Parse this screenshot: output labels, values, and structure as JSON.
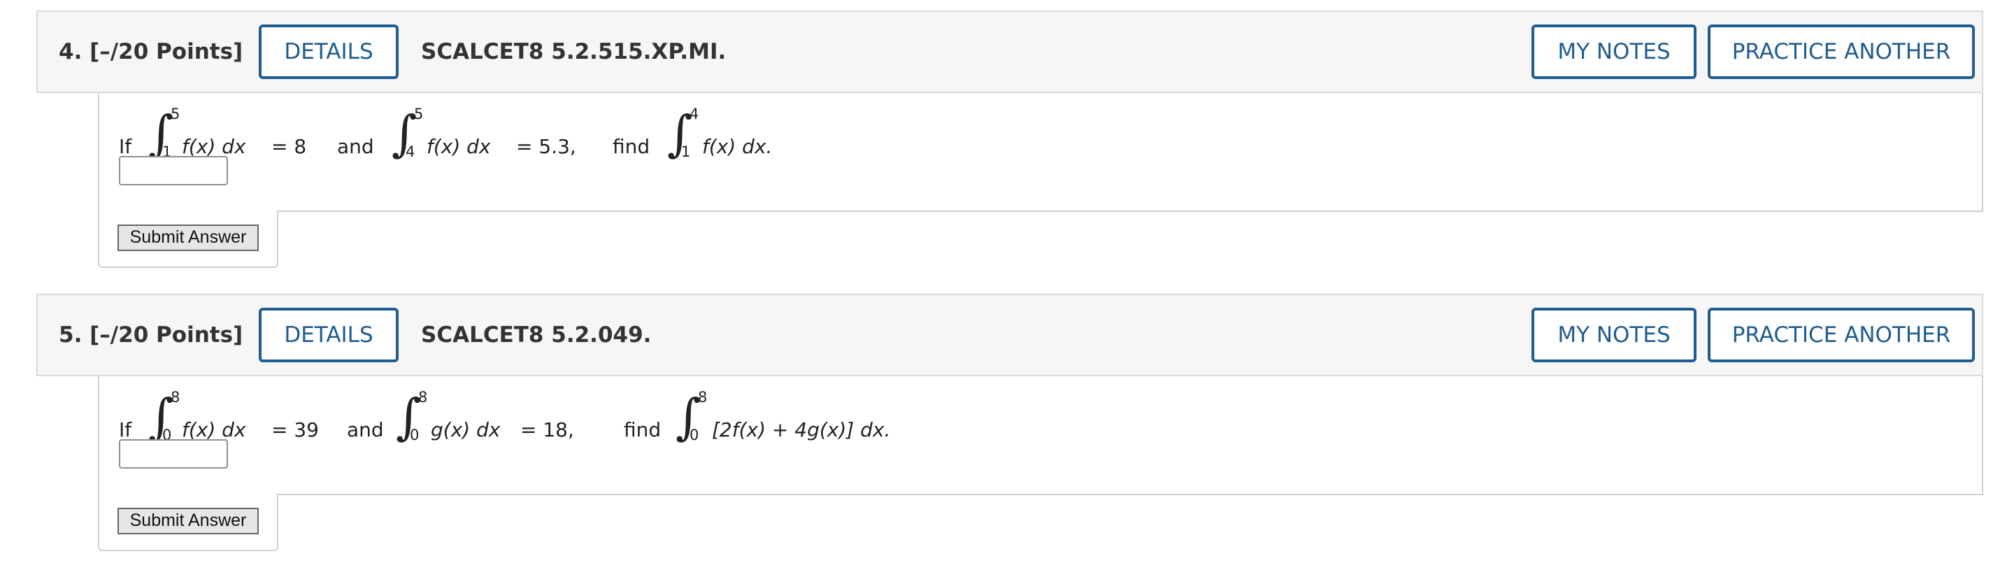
{
  "questions": [
    {
      "number": "4.  [–/20 Points]",
      "details_label": "DETAILS",
      "code": "SCALCET8 5.2.515.XP.MI.",
      "my_notes_label": "MY NOTES",
      "practice_label": "PRACTICE ANOTHER",
      "statement": {
        "if": "If",
        "int1": {
          "lower": "1",
          "upper": "5",
          "integrand": "f(x) dx",
          "rel": "= 8"
        },
        "and": "and",
        "int2": {
          "lower": "4",
          "upper": "5",
          "integrand": "f(x) dx",
          "rel": "= 5.3,"
        },
        "find": "find",
        "int3": {
          "lower": "1",
          "upper": "4",
          "integrand": "f(x) dx."
        }
      },
      "answer_value": "",
      "submit_label": "Submit Answer"
    },
    {
      "number": "5.  [–/20 Points]",
      "details_label": "DETAILS",
      "code": "SCALCET8 5.2.049.",
      "my_notes_label": "MY NOTES",
      "practice_label": "PRACTICE ANOTHER",
      "statement": {
        "if": "If",
        "int1": {
          "lower": "0",
          "upper": "8",
          "integrand": "f(x) dx",
          "rel": "= 39"
        },
        "and": "and",
        "int2": {
          "lower": "0",
          "upper": "8",
          "integrand": "g(x) dx",
          "rel": "= 18,"
        },
        "find": "find",
        "int3": {
          "lower": "0",
          "upper": "8",
          "integrand": "[2f(x) + 4g(x)] dx."
        }
      },
      "answer_value": "",
      "submit_label": "Submit Answer"
    }
  ],
  "colors": {
    "accent": "#1f5c8f",
    "header_bg": "#f6f6f6",
    "border": "#d0d0d0"
  }
}
